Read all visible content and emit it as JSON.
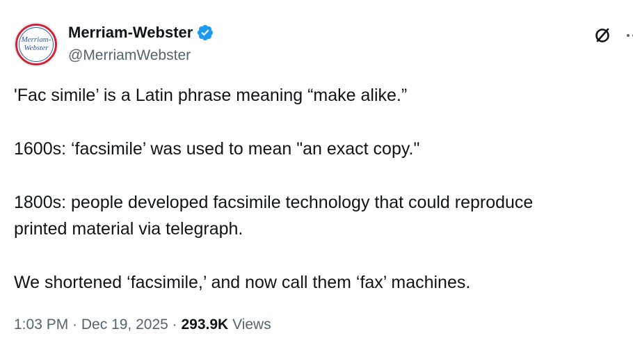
{
  "author": {
    "display_name": "Merriam-Webster",
    "handle": "@MerriamWebster",
    "avatar_text_line1": "Merriam-",
    "avatar_text_line2": "Webster",
    "verified": true,
    "verified_color": "#1d9bf0"
  },
  "actions": {
    "grok_icon": "grok-slash-circle-icon",
    "more_icon": "more-dots-icon"
  },
  "tweet": {
    "paragraphs": [
      "'Fac simile’ is a Latin phrase meaning “make alike.”",
      "1600s: ‘facsimile’ was used to mean \"an exact copy.\"",
      "1800s: people developed facsimile technology that could reproduce\nprinted material via telegraph.",
      "We shortened ‘facsimile,’ and now call them ‘fax’ machines."
    ]
  },
  "meta": {
    "time": "1:03 PM",
    "separator": " · ",
    "date": "Dec 19, 2025",
    "views_count": "293.9K",
    "views_label": "Views"
  },
  "colors": {
    "text_primary": "#0f1419",
    "text_secondary": "#536471",
    "brand_red": "#d0213a",
    "brand_blue": "#2c5aa0"
  }
}
